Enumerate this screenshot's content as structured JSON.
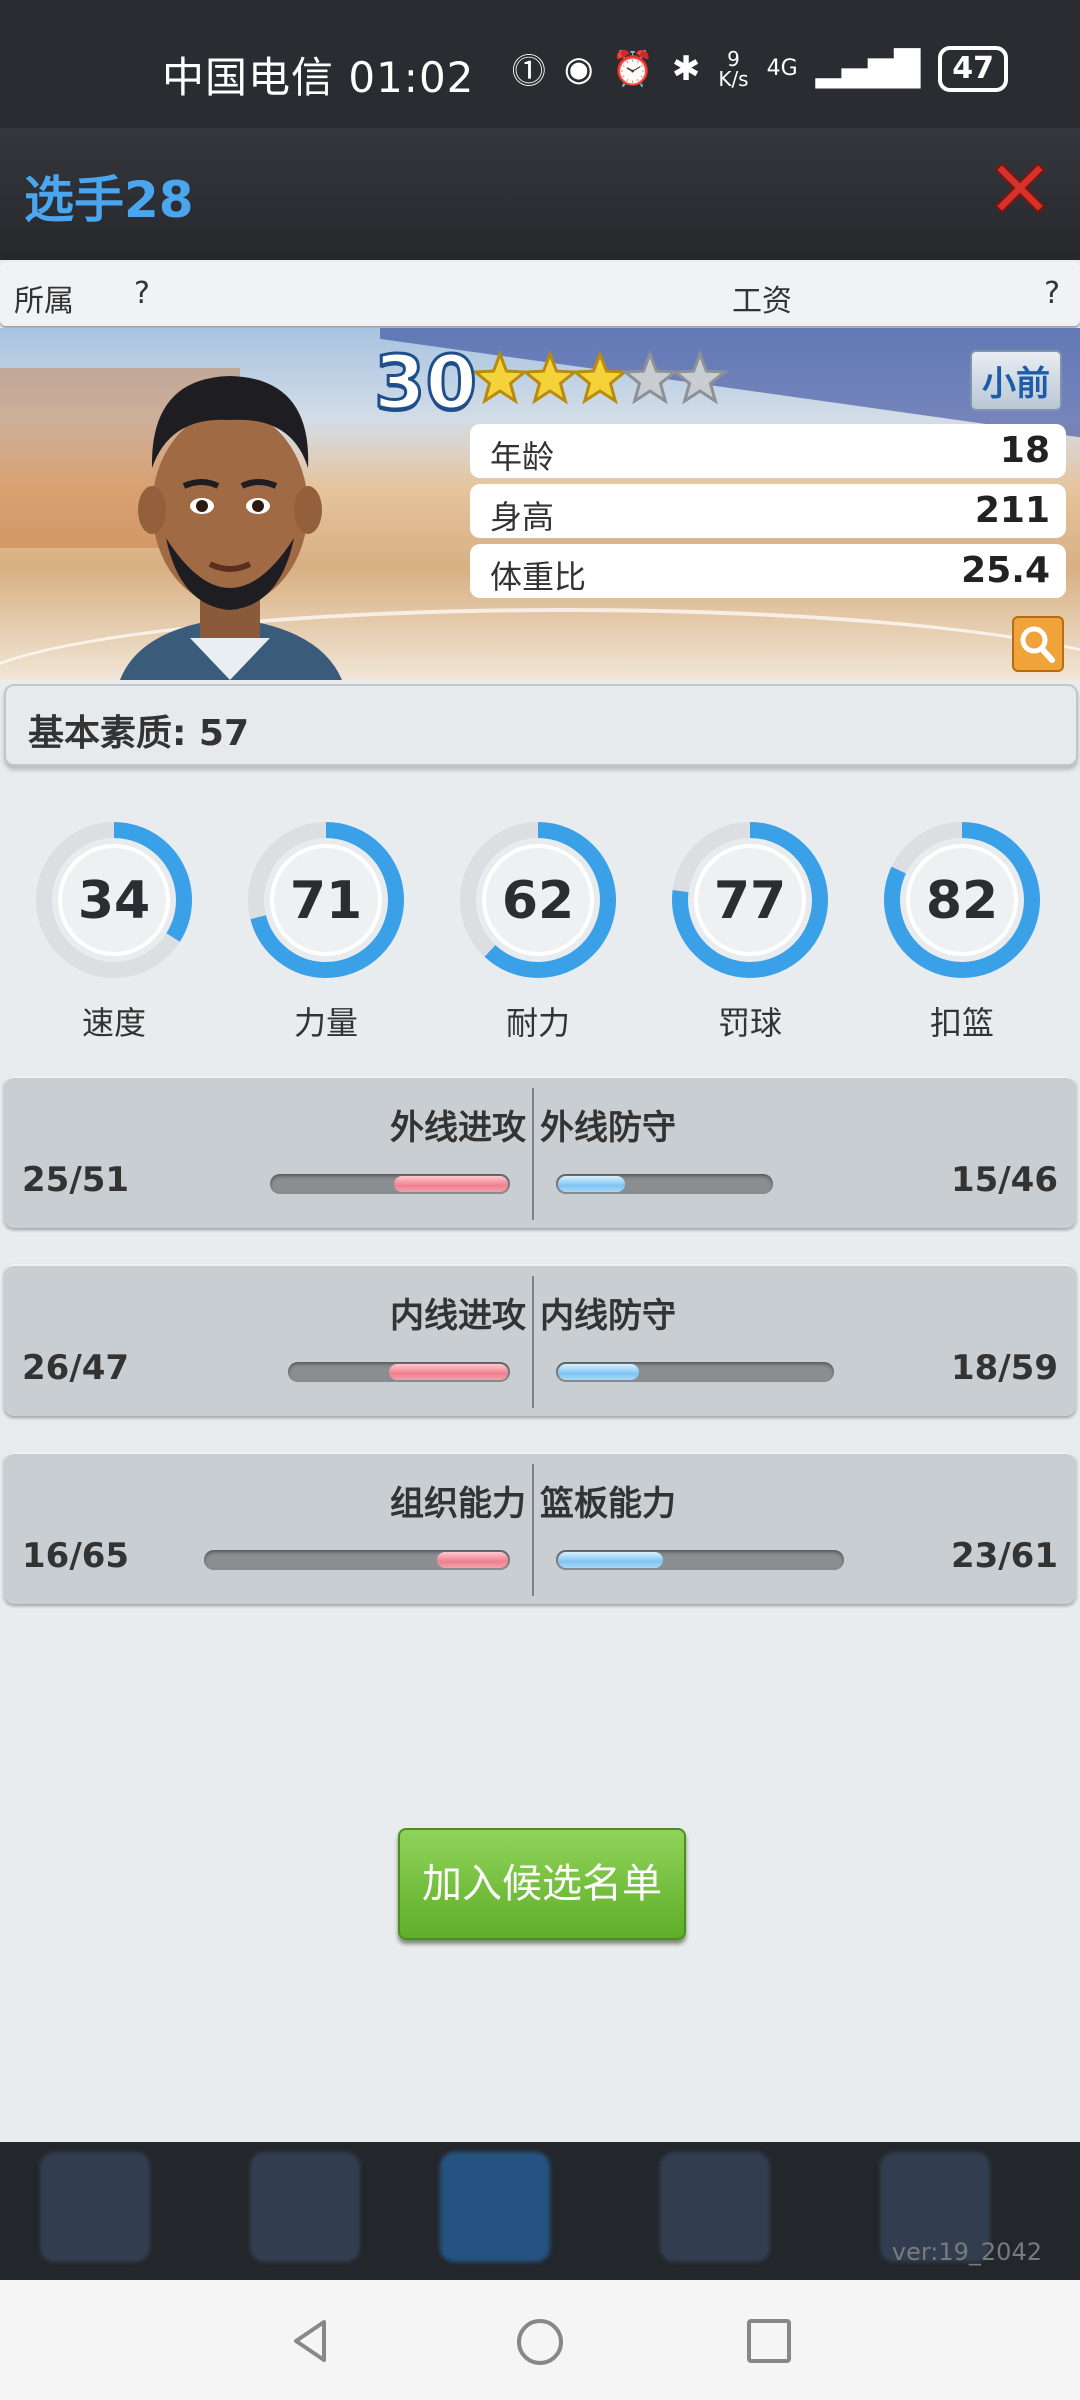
{
  "status_bar": {
    "carrier_time": "中国电信 01:02",
    "net_speed_top": "9",
    "net_speed_unit": "K/s",
    "network": "4G",
    "battery": "47"
  },
  "header": {
    "title": "选手28",
    "close_icon": "close-x-icon"
  },
  "info_bar": {
    "team_label": "所属",
    "team_value": "?",
    "salary_label": "工资",
    "salary_value": "?"
  },
  "profile": {
    "level": "30",
    "stars_filled": 3,
    "stars_total": 5,
    "position": "小前",
    "age_label": "年龄",
    "age": "18",
    "height_label": "身高",
    "height": "211",
    "weight_ratio_label": "体重比",
    "weight_ratio": "25.4"
  },
  "base_quality": {
    "text": "基本素质: 57"
  },
  "attributes": [
    {
      "label": "速度",
      "value": "34"
    },
    {
      "label": "力量",
      "value": "71"
    },
    {
      "label": "耐力",
      "value": "62"
    },
    {
      "label": "罚球",
      "value": "77"
    },
    {
      "label": "扣篮",
      "value": "82"
    }
  ],
  "skill_panels": [
    {
      "left_label": "外线进攻",
      "left_value": "25/51",
      "left_current": 25,
      "left_max": 51,
      "right_label": "外线防守",
      "right_value": "15/46",
      "right_current": 15,
      "right_max": 46
    },
    {
      "left_label": "内线进攻",
      "left_value": "26/47",
      "left_current": 26,
      "left_max": 47,
      "right_label": "内线防守",
      "right_value": "18/59",
      "right_current": 18,
      "right_max": 59
    },
    {
      "left_label": "组织能力",
      "left_value": "16/65",
      "left_current": 16,
      "left_max": 65,
      "right_label": "篮板能力",
      "right_value": "23/61",
      "right_current": 23,
      "right_max": 61
    }
  ],
  "actions": {
    "add_shortlist": "加入候选名单"
  },
  "footer": {
    "version": "ver:19_2042"
  },
  "colors": {
    "title_blue": "#4aa6ee",
    "ring_blue": "#3aa0e8",
    "button_green": "#6cbc32",
    "close_red": "#d6322b"
  }
}
